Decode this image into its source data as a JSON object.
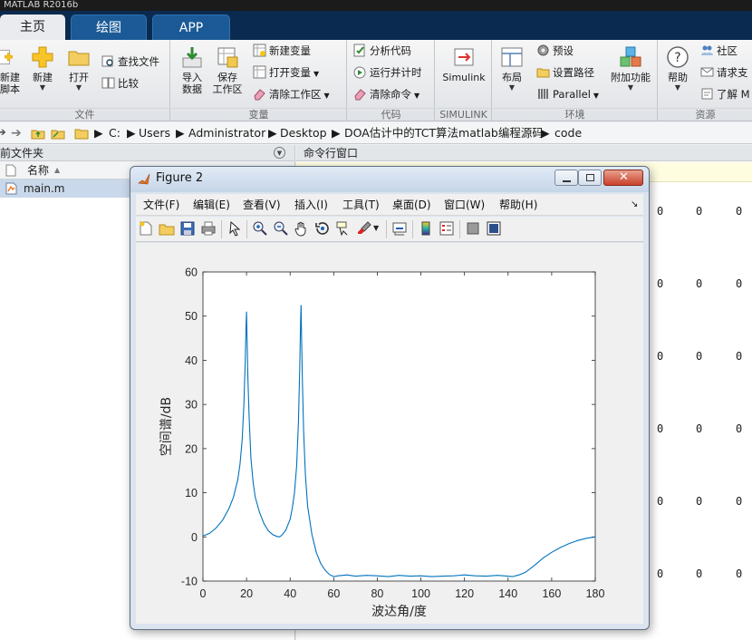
{
  "app": {
    "title": "MATLAB R2016b"
  },
  "tabs": [
    {
      "label": "主页",
      "active": true
    },
    {
      "label": "绘图",
      "active": false
    },
    {
      "label": "APP",
      "active": false
    }
  ],
  "toolstrip": {
    "file": {
      "label": "文件",
      "new_script": "新建\n脚本",
      "new": "新建",
      "open": "打开",
      "find_files": "查找文件",
      "compare": "比较"
    },
    "variable": {
      "label": "变量",
      "import_data": "导入\n数据",
      "save_workspace": "保存\n工作区",
      "new_variable": "新建变量",
      "open_variable": "打开变量",
      "clear_workspace": "清除工作区"
    },
    "code": {
      "label": "代码",
      "analyze": "分析代码",
      "run_time": "运行并计时",
      "clear_commands": "清除命令"
    },
    "simulink": {
      "label": "SIMULINK",
      "button": "Simulink"
    },
    "environment": {
      "label": "环境",
      "layout": "布局",
      "preferences": "预设",
      "set_path": "设置路径",
      "parallel": "Parallel",
      "addons": "附加功能"
    },
    "resources": {
      "label": "资源",
      "help": "帮助",
      "community": "社区",
      "request_support": "请求支",
      "learn": "了解 M"
    }
  },
  "address": {
    "crumbs": [
      "C:",
      "Users",
      "Administrator",
      "Desktop",
      "DOA估计中的TCT算法matlab编程源码",
      "code"
    ]
  },
  "left_panel": {
    "title": "当前文件夹",
    "column_name": "名称",
    "files": [
      "main.m"
    ]
  },
  "right_panel": {
    "title": "命令行窗口",
    "rows": [
      [
        "0",
        "0",
        "0"
      ],
      [
        "0",
        "0",
        "0"
      ],
      [
        "0",
        "0",
        "0"
      ],
      [
        "0",
        "0",
        "0"
      ],
      [
        "0",
        "0",
        "0"
      ],
      [
        "0",
        "0",
        "0"
      ]
    ]
  },
  "figure": {
    "title": "Figure 2",
    "menu": [
      "文件(F)",
      "编辑(E)",
      "查看(V)",
      "插入(I)",
      "工具(T)",
      "桌面(D)",
      "窗口(W)",
      "帮助(H)"
    ],
    "toolbar_icons": [
      "new-figure-icon",
      "open-file-icon",
      "save-icon",
      "print-icon",
      "pointer-icon",
      "zoom-in-icon",
      "zoom-out-icon",
      "pan-hand-icon",
      "rotate-3d-icon",
      "data-cursor-icon",
      "brush-icon",
      "link-plot-icon",
      "colorbar-icon",
      "legend-icon",
      "hide-plot-tools-icon",
      "show-plot-tools-icon"
    ]
  },
  "chart_data": {
    "type": "line",
    "title": "",
    "xlabel": "波达角/度",
    "ylabel": "空间谱/dB",
    "xlim": [
      0,
      180
    ],
    "ylim": [
      -10,
      60
    ],
    "xticks": [
      0,
      20,
      40,
      60,
      80,
      100,
      120,
      140,
      160,
      180
    ],
    "yticks": [
      -10,
      0,
      10,
      20,
      30,
      40,
      50,
      60
    ],
    "grid": false,
    "line_color": "#0072BD",
    "series": [
      {
        "x": [
          0,
          3,
          6,
          9,
          12,
          14,
          16,
          17,
          18,
          18.8,
          19.4,
          19.8,
          20,
          20.2,
          20.6,
          21.2,
          22,
          23,
          24,
          26,
          28,
          30,
          32,
          34,
          35,
          36,
          38,
          40,
          41,
          42,
          43,
          43.8,
          44.4,
          44.8,
          45,
          45.2,
          45.6,
          46.2,
          47,
          48,
          50,
          52,
          54,
          56,
          58,
          60,
          62,
          66,
          70,
          75,
          80,
          85,
          90,
          95,
          100,
          105,
          110,
          115,
          120,
          125,
          130,
          135,
          140,
          142,
          145,
          148,
          152,
          156,
          160,
          164,
          168,
          172,
          176,
          180
        ],
        "y": [
          0.2,
          0.8,
          2.0,
          3.8,
          6.5,
          9.0,
          13.0,
          16.5,
          22.0,
          30.0,
          40.0,
          48.0,
          51.0,
          46.0,
          36.0,
          27.0,
          18.0,
          12.5,
          9.0,
          5.5,
          3.0,
          1.4,
          0.5,
          0.1,
          0.0,
          0.3,
          1.5,
          4.0,
          6.5,
          10.0,
          16.0,
          26.0,
          38.0,
          49.0,
          52.5,
          47.0,
          36.0,
          24.0,
          14.0,
          7.0,
          0.5,
          -3.5,
          -6.0,
          -7.5,
          -8.5,
          -9.0,
          -8.8,
          -8.6,
          -8.9,
          -8.7,
          -8.8,
          -9.0,
          -8.7,
          -8.9,
          -8.8,
          -9.0,
          -8.9,
          -8.8,
          -8.6,
          -8.8,
          -8.9,
          -8.7,
          -8.9,
          -9.0,
          -8.6,
          -8.0,
          -6.5,
          -4.8,
          -3.5,
          -2.4,
          -1.5,
          -0.8,
          -0.3,
          0.0
        ]
      }
    ]
  },
  "colors": {
    "tabbar": "#0b2a4f",
    "accent_tab": "#1b5a96",
    "line": "#0072BD",
    "selected_file": "#c9d8ea"
  }
}
